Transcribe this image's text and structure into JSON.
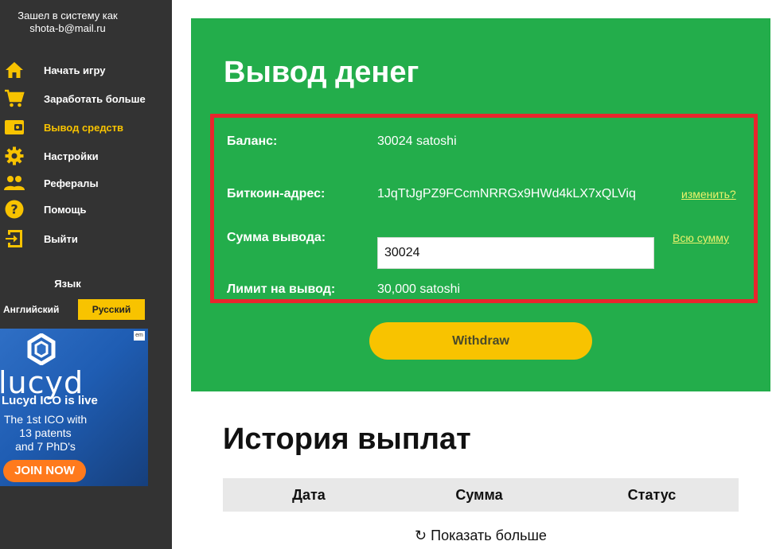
{
  "sidebar": {
    "login_line1": "Зашел в систему как",
    "login_line2": "shota-b@mail.ru",
    "menu": [
      {
        "label": "Начать игру",
        "icon": "home-icon"
      },
      {
        "label": "Заработать больше",
        "icon": "cart-icon"
      },
      {
        "label": "Вывод средств",
        "icon": "wallet-icon",
        "active": true
      },
      {
        "label": "Настройки",
        "icon": "gear-icon"
      },
      {
        "label": "Рефералы",
        "icon": "users-icon"
      },
      {
        "label": "Помощь",
        "icon": "help-icon"
      },
      {
        "label": "Выйти",
        "icon": "logout-icon"
      }
    ],
    "language_title": "Язык",
    "languages": [
      "Английский",
      "Русский"
    ],
    "active_language": "Русский"
  },
  "ad": {
    "brand": "lucyd",
    "headline": "Lucyd ICO is live",
    "text_lines": [
      "The 1st ICO with",
      "13 patents",
      "and 7 PhD's"
    ],
    "cta": "JOIN NOW",
    "badge": "em"
  },
  "withdraw": {
    "title": "Вывод денег",
    "balance_label": "Баланс:",
    "balance_value": "30024 satoshi",
    "address_label": "Биткоин-адрес:",
    "address_value": "1JqTtJgPZ9FCcmNRRGx9HWd4kLX7xQLViq",
    "change_link": "изменить?",
    "amount_label": "Сумма вывода:",
    "amount_value": "30024",
    "all_link": "Всю сумму",
    "limit_label": "Лимит на вывод:",
    "limit_value": "30,000 satoshi",
    "button": "Withdraw"
  },
  "history": {
    "title": "История выплат",
    "columns": [
      "Дата",
      "Сумма",
      "Статус"
    ],
    "show_more": "Показать больше"
  },
  "colors": {
    "sidebar_bg": "#333333",
    "accent_yellow": "#f8c300",
    "panel_green": "#23ad4b",
    "highlight_red": "#e8262d"
  }
}
